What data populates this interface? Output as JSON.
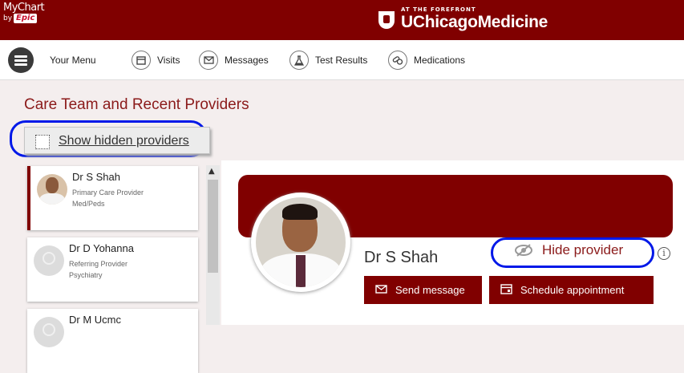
{
  "header": {
    "app_logo_line1": "MyChart",
    "app_logo_line2": "by",
    "app_logo_vendor": "Epic",
    "org_tagline": "AT THE FOREFRONT",
    "org_name": "UChicagoMedicine"
  },
  "nav": {
    "menu_label": "Your Menu",
    "items": [
      {
        "label": "Visits",
        "icon": "calendar-icon"
      },
      {
        "label": "Messages",
        "icon": "envelope-icon"
      },
      {
        "label": "Test Results",
        "icon": "flask-icon"
      },
      {
        "label": "Medications",
        "icon": "pills-icon"
      }
    ]
  },
  "page": {
    "title": "Care Team and Recent Providers",
    "show_hidden_label": "Show hidden providers"
  },
  "providers": [
    {
      "name": "Dr S Shah",
      "role": "Primary Care Provider",
      "specialty": "Med/Peds",
      "selected": true
    },
    {
      "name": "Dr D Yohanna",
      "role": "Referring Provider",
      "specialty": "Psychiatry",
      "selected": false
    },
    {
      "name": "Dr M Ucmc",
      "role": "",
      "specialty": "",
      "selected": false
    }
  ],
  "detail": {
    "name": "Dr S Shah",
    "hide_label": "Hide provider",
    "send_message_label": "Send message",
    "schedule_label": "Schedule appointment"
  },
  "colors": {
    "brand": "#800000",
    "highlight_ring": "#0018e8"
  }
}
